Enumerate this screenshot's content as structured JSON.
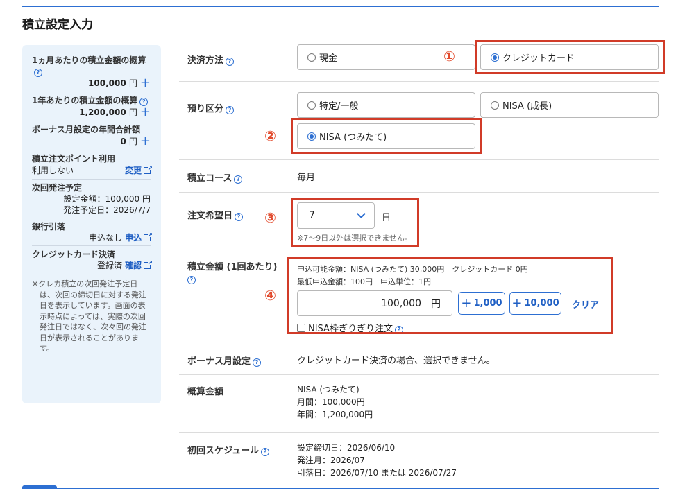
{
  "page_title": "積立設定入力",
  "sidebar": {
    "monthly_label": "1ヵ月あたりの積立金額の概算",
    "monthly_value": "100,000",
    "yen": "円",
    "yearly_label": "1年あたりの積立金額の概算",
    "yearly_value": "1,200,000",
    "bonus_label": "ボーナス月設定の年間合計額",
    "bonus_value": "0",
    "points_label": "積立注文ポイント利用",
    "points_value": "利用しない",
    "points_link": "変更",
    "next_order_label": "次回発注予定",
    "next_order_amount": "設定金額：100,000 円",
    "next_order_date": "発注予定日：2026/7/7",
    "bank_label": "銀行引落",
    "bank_status": "申込なし",
    "bank_link": "申込",
    "card_label": "クレジットカード決済",
    "card_status": "登録済",
    "card_link": "確認",
    "note": "※クレカ積立の次回発注予定日は、次回の締切日に対する発注日を表示しています。画面の表示時点によっては、実際の次回発注日ではなく、次々回の発注日が表示されることがあります。"
  },
  "form": {
    "payment": {
      "label": "決済方法",
      "options": [
        "現金",
        "クレジットカード"
      ],
      "selected": "クレジットカード"
    },
    "account": {
      "label": "預り区分",
      "options": [
        "特定/一般",
        "NISA (成長)",
        "NISA (つみたて)"
      ],
      "selected": "NISA (つみたて)"
    },
    "course": {
      "label": "積立コース",
      "value": "毎月"
    },
    "order_day": {
      "label": "注文希望日",
      "value": "7",
      "unit": "日",
      "note": "※7〜9日以外は選択できません。"
    },
    "amount": {
      "label_line1": "積立金額 (1回あたり)",
      "available": "申込可能金額：NISA (つみたて) 30,000円　クレジットカード 0円",
      "min": "最低申込金額：100円　申込単位：1円",
      "value": "100,000",
      "unit": "円",
      "inc1": "1,000",
      "inc2": "10,000",
      "clear": "クリア",
      "nisa_check": "NISA枠ぎりぎり注文"
    },
    "bonus": {
      "label": "ボーナス月設定",
      "value": "クレジットカード決済の場合、選択できません。"
    },
    "estimate": {
      "label": "概算金額",
      "line1": "NISA (つみたて)",
      "line2": "月間：100,000円",
      "line3": "年間：1,200,000円"
    },
    "schedule": {
      "label": "初回スケジュール",
      "line1": "設定締切日：2026/06/10",
      "line2": "発注月：2026/07",
      "line3": "引落日：2026/07/10 または 2026/07/27"
    }
  },
  "annotations": [
    "①",
    "②",
    "③",
    "④"
  ],
  "colors": {
    "accent": "#2d6fd2",
    "highlight": "#d13b28",
    "annotation": "#e24a2c",
    "sidebar_bg": "#eaf3fb"
  }
}
